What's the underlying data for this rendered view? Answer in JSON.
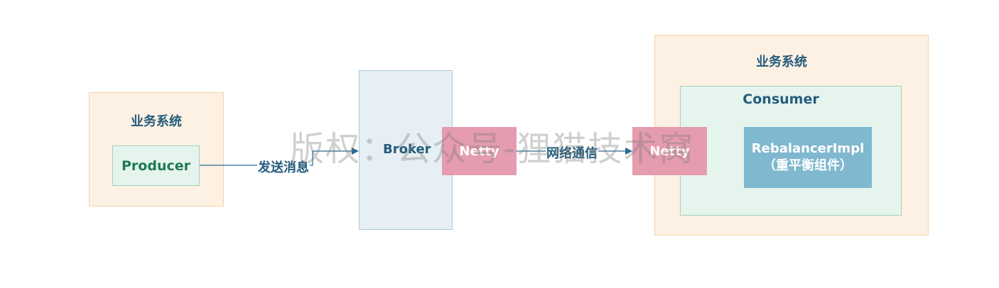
{
  "diagram": {
    "producer_system": {
      "title": "业务系统",
      "producer_label": "Producer"
    },
    "edge_send": {
      "label": "发送消息"
    },
    "broker": {
      "label": "Broker",
      "netty_label": "Netty"
    },
    "edge_network": {
      "label": "网络通信"
    },
    "consumer_system": {
      "title": "业务系统",
      "consumer_title": "Consumer",
      "netty_label": "Netty",
      "rebalancer_line1": "RebalancerImpl",
      "rebalancer_line2": "（重平衡组件）"
    },
    "colors": {
      "system_fill": "#fdf1e3",
      "system_border": "#f6d2a6",
      "component_fill": "#e6f4ee",
      "broker_fill": "#e6eff3",
      "netty_fill": "#e49cae",
      "rebalancer_fill": "#80b8cf",
      "text": "#245c7d",
      "arrow": "#2b6a90"
    }
  },
  "watermark": {
    "text": "版权：公众号-狸猫技术窝"
  }
}
